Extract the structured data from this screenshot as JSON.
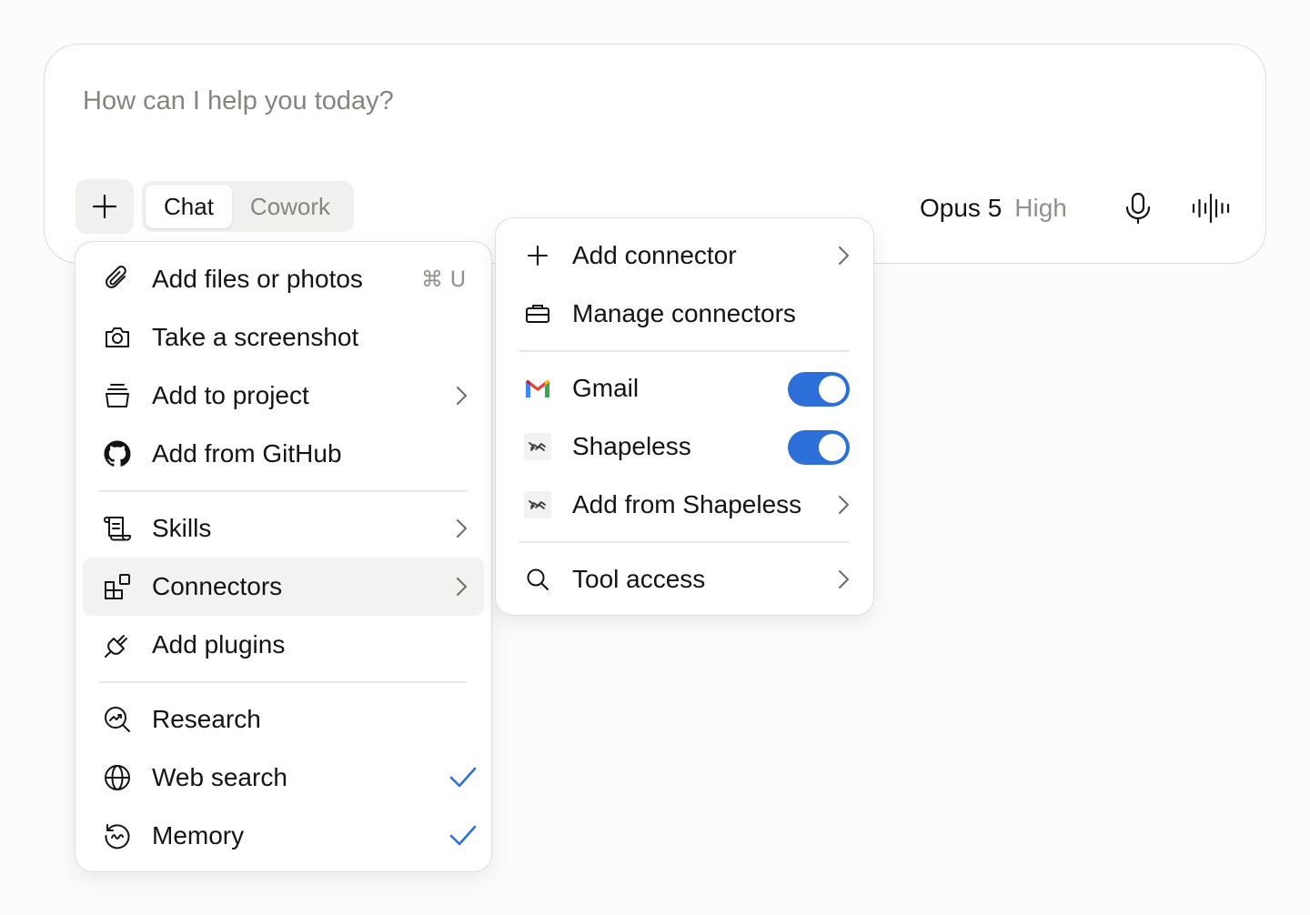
{
  "composer": {
    "placeholder": "How can I help you today?",
    "modes": [
      {
        "label": "Chat",
        "active": true
      },
      {
        "label": "Cowork",
        "active": false
      }
    ],
    "model": {
      "name": "Opus 5",
      "effort": "High"
    },
    "icons": {
      "add": "plus-icon",
      "mic": "microphone-icon",
      "voice": "voice-waveform-icon"
    }
  },
  "menu": {
    "items": [
      {
        "label": "Add files or photos",
        "icon": "paperclip-icon",
        "shortcut": "⌘ U"
      },
      {
        "label": "Take a screenshot",
        "icon": "camera-icon"
      },
      {
        "label": "Add to project",
        "icon": "project-box-icon",
        "submenu": true
      },
      {
        "label": "Add from GitHub",
        "icon": "github-icon"
      },
      {
        "label": "Skills",
        "icon": "scroll-icon",
        "submenu": true
      },
      {
        "label": "Connectors",
        "icon": "connectors-icon",
        "submenu": true,
        "highlighted": true
      },
      {
        "label": "Add plugins",
        "icon": "plug-icon"
      },
      {
        "label": "Research",
        "icon": "research-icon"
      },
      {
        "label": "Web search",
        "icon": "globe-icon",
        "checked": true
      },
      {
        "label": "Memory",
        "icon": "memory-icon",
        "checked": true
      }
    ]
  },
  "connectors_menu": {
    "items": [
      {
        "label": "Add connector",
        "icon": "plus-icon",
        "submenu": true
      },
      {
        "label": "Manage connectors",
        "icon": "briefcase-icon"
      },
      {
        "label": "Gmail",
        "icon": "gmail-icon",
        "enabled": true
      },
      {
        "label": "Shapeless",
        "icon": "shapeless-icon",
        "enabled": true
      },
      {
        "label": "Add from Shapeless",
        "icon": "shapeless-icon",
        "submenu": true
      },
      {
        "label": "Tool access",
        "icon": "search-icon",
        "submenu": true
      }
    ]
  },
  "colors": {
    "accent": "#2c6fd9",
    "highlight": "#f2f2f0",
    "muted_text": "#858580"
  }
}
